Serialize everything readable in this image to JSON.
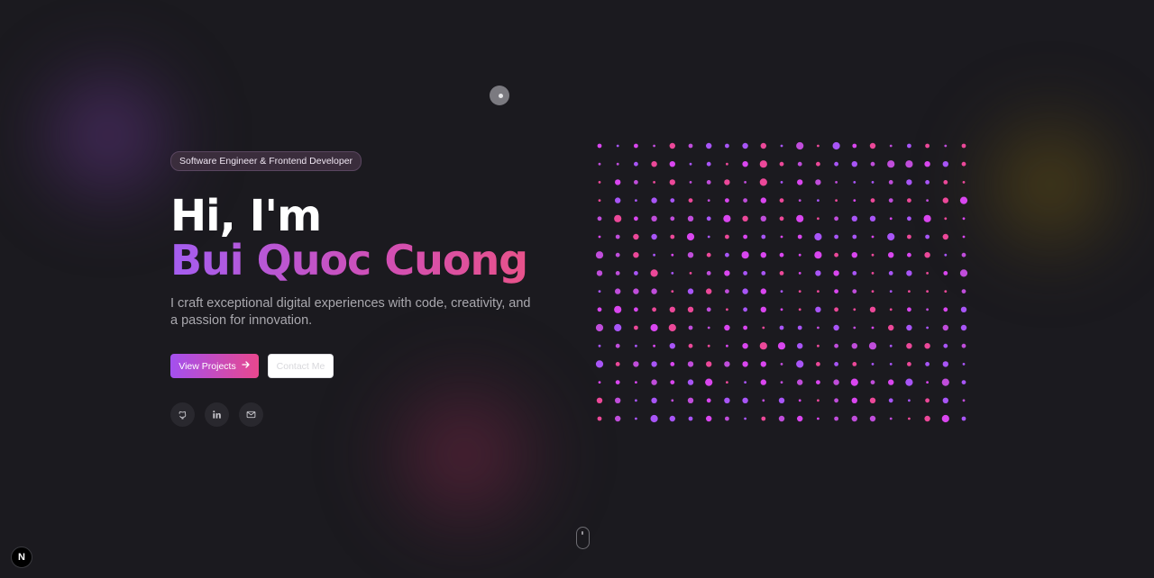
{
  "hero": {
    "badge": "Software Engineer & Frontend Developer",
    "greeting": "Hi, I'm",
    "name": "Bui Quoc Cuong",
    "tagline": "I craft exceptional digital experiences with code, creativity, and a passion for innovation.",
    "primary_button": "View Projects",
    "secondary_button": "Contact Me"
  },
  "social": [
    {
      "name": "github-icon"
    },
    {
      "name": "linkedin-icon"
    },
    {
      "name": "mail-icon"
    }
  ],
  "dev_indicator": "N",
  "colors": {
    "background": "#1b1a1f",
    "accent_purple": "#a45ef0",
    "accent_pink": "#e8528a",
    "dot_purple": "#a855f7",
    "dot_pink": "#ec4899"
  },
  "dot_grid": {
    "columns": 21,
    "rows": 16
  }
}
